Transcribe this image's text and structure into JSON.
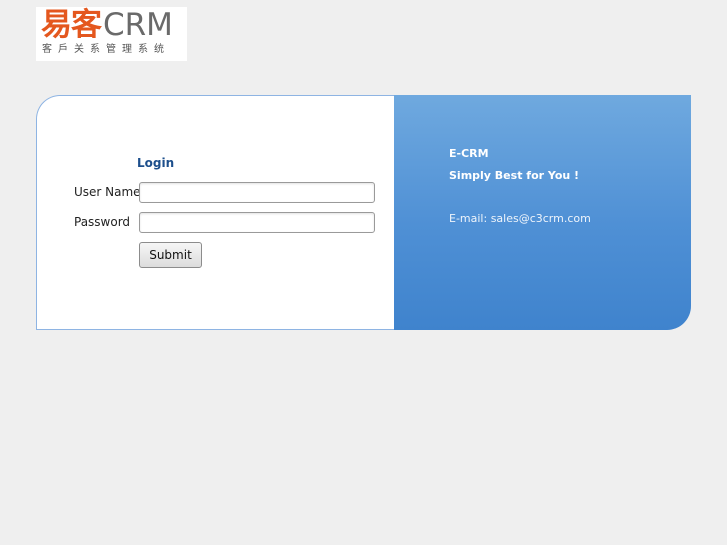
{
  "logo": {
    "cn": "易客",
    "crm": "CRM",
    "subtitle": "客戶关系管理系统"
  },
  "login": {
    "title": "Login",
    "username_label": "User Name",
    "password_label": "Password",
    "username_value": "",
    "password_value": "",
    "submit_label": "Submit"
  },
  "info": {
    "title": "E-CRM",
    "tagline": "Simply Best for You !",
    "email": "E-mail: sales@c3crm.com"
  },
  "colors": {
    "background": "#efefef",
    "logo_accent": "#e4571e",
    "login_title": "#1d4f8c",
    "panel_blue": "#4f90d5"
  }
}
